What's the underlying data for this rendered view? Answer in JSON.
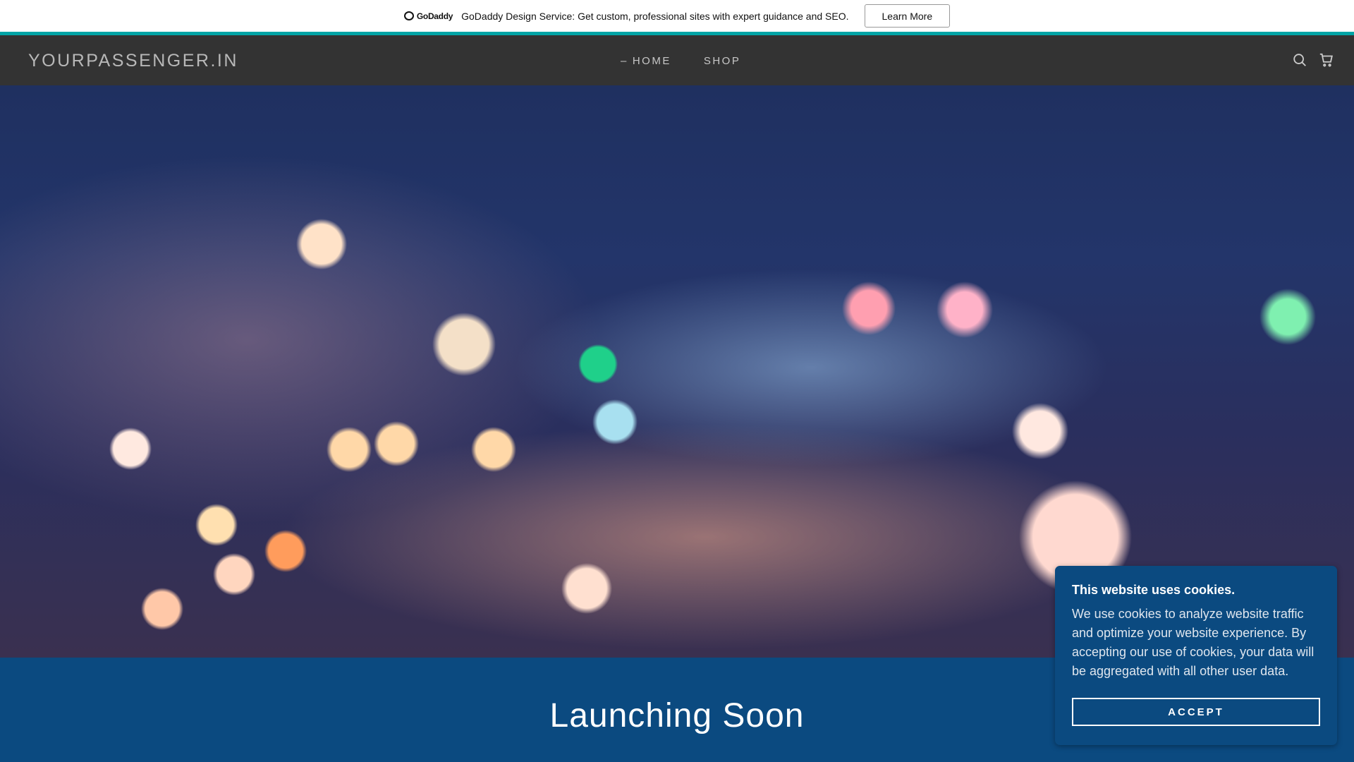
{
  "banner": {
    "brand": "GoDaddy",
    "message": "GoDaddy Design Service: Get custom, professional sites with expert guidance and SEO.",
    "button": "Learn More"
  },
  "nav": {
    "logo": "YOURPASSENGER.IN",
    "items": [
      {
        "label": "HOME",
        "active": true
      },
      {
        "label": "SHOP"
      }
    ],
    "icons": [
      "search-icon",
      "cart-icon"
    ]
  },
  "hero": {
    "title": "Launching Soon"
  },
  "cookie": {
    "title": "This website uses cookies.",
    "body": "We use cookies to analyze website traffic and optimize your website experience. By accepting our use of cookies, your data will be aggregated with all other user data.",
    "button": "ACCEPT"
  },
  "colors": {
    "teal": "#00a4a6",
    "nav": "#333333",
    "section": "#0b4a80"
  }
}
